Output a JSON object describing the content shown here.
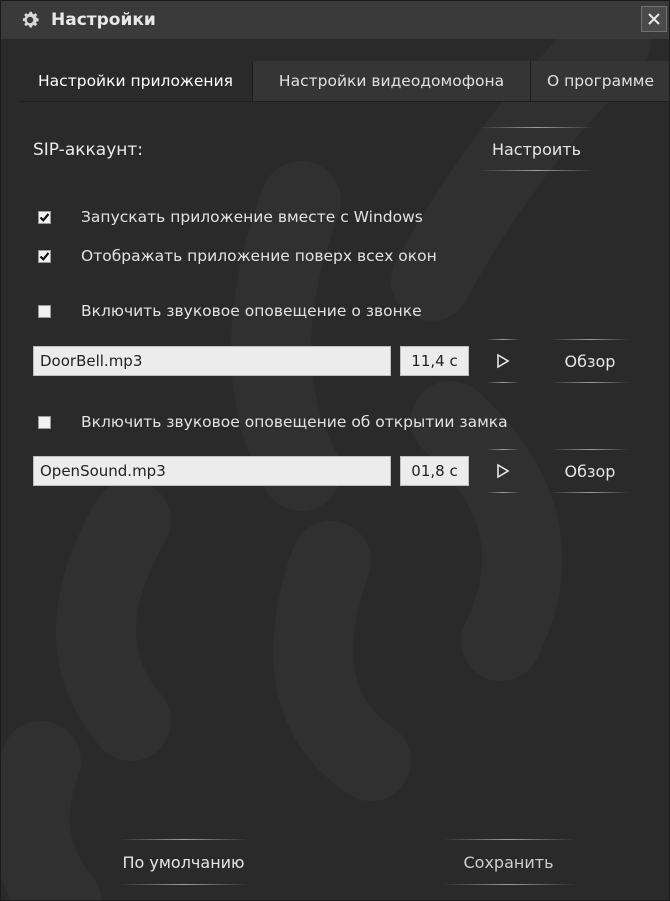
{
  "window": {
    "title": "Настройки"
  },
  "tabs": [
    {
      "label": "Настройки приложения",
      "active": true
    },
    {
      "label": "Настройки видеодомофона",
      "active": false
    },
    {
      "label": "О программе",
      "active": false
    }
  ],
  "sip": {
    "label": "SIP-аккаунт:",
    "button": "Настроить"
  },
  "options": {
    "autostart": {
      "label": "Запускать приложение вместе с Windows",
      "checked": true
    },
    "topmost": {
      "label": "Отображать приложение поверх всех окон",
      "checked": true
    },
    "ring_sound": {
      "label": "Включить звуковое оповещение о звонке",
      "checked": false
    },
    "lock_sound": {
      "label": "Включить звуковое оповещение об открытии замка",
      "checked": false
    }
  },
  "ring_file": {
    "filename": "DoorBell.mp3",
    "duration": "11,4 с",
    "browse": "Обзор"
  },
  "lock_file": {
    "filename": "OpenSound.mp3",
    "duration": "01,8 с",
    "browse": "Обзор"
  },
  "footer": {
    "default_label": "По умолчанию",
    "save_label": "Сохранить"
  },
  "colors": {
    "background": "#2a2a2a",
    "titlebar": "#3a3a3a",
    "text": "#e6e6e6",
    "input": "#ececec"
  }
}
